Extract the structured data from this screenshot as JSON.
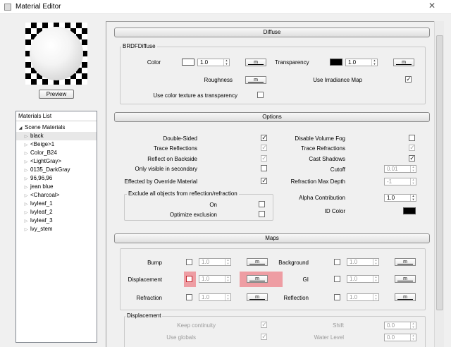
{
  "window": {
    "title": "Material Editor",
    "close_glyph": "✕"
  },
  "preview": {
    "button_label": "Preview"
  },
  "materials_list": {
    "header": "Materials List",
    "root": "Scene Materials",
    "items": [
      "black",
      "<Beige>1",
      "Color_B24",
      "<LightGray>",
      "0135_DarkGray",
      "96,96,96",
      "jean blue",
      "<Charcoal>",
      "lvyleaf_1",
      "lvyleaf_2",
      "lvyleaf_3",
      "lvy_stem"
    ],
    "selected_index": 0
  },
  "diffuse": {
    "header": "Diffuse",
    "group_title": "BRDFDiffuse",
    "color_label": "Color",
    "color_swatch": "#ffffff",
    "color_value": "1.0",
    "map_button": "m",
    "transparency_label": "Transparency",
    "transparency_swatch": "#000000",
    "transparency_value": "1.0",
    "roughness_label": "Roughness",
    "irradiance_label": "Use Irradiance Map",
    "irradiance_checked": true,
    "color_texture_label": "Use color texture as transparency",
    "color_texture_checked": false
  },
  "options": {
    "header": "Options",
    "double_sided": "Double-Sided",
    "trace_reflections": "Trace Reflections",
    "reflect_backside": "Reflect on Backside",
    "only_visible": "Only visible in secondary",
    "effected_override": "Effected by Override Material",
    "disable_fog": "Disable Volume Fog",
    "trace_refractions": "Trace Refractions",
    "cast_shadows": "Cast Shadows",
    "cutoff": "Cutoff",
    "cutoff_value": "0.01",
    "refraction_depth": "Refraction Max Depth",
    "refraction_depth_value": "-1",
    "alpha_contribution": "Alpha Contribution",
    "alpha_value": "1.0",
    "id_color": "ID Color",
    "id_color_swatch": "#000000",
    "exclude_title": "Exclude all objects from reflection/refraction",
    "exclude_on": "On",
    "optimize_exclusion": "Optimize exclusion"
  },
  "maps": {
    "header": "Maps",
    "bump": "Bump",
    "displacement": "Displacement",
    "refraction": "Refraction",
    "background": "Background",
    "gi": "GI",
    "reflection": "Reflection",
    "value": "1.0",
    "map_button": "m",
    "displacement_group": "Displacement",
    "keep_continuity": "Keep continuity",
    "use_globals": "Use globals",
    "shift": "Shift",
    "shift_value": "0.0",
    "water_level": "Water Level",
    "water_value": "0.0"
  },
  "colors": {
    "highlight": "#ec5a64"
  }
}
